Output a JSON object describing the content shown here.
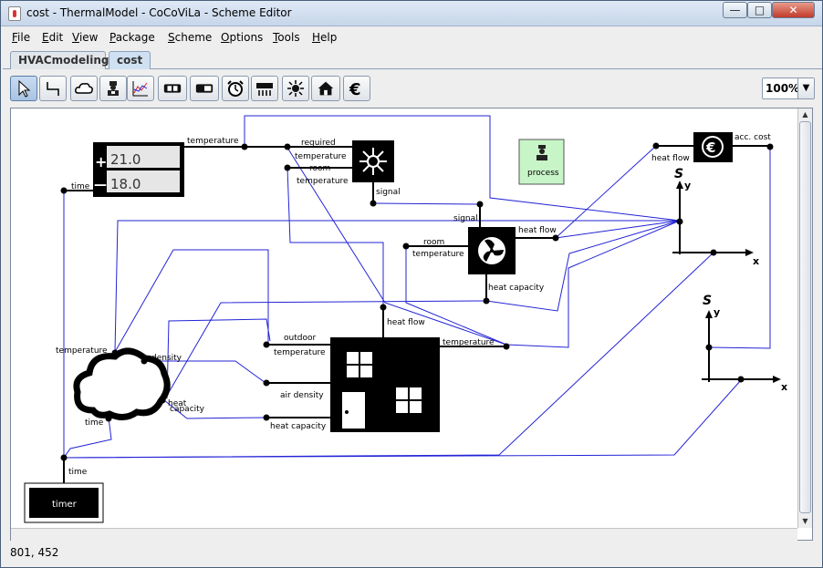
{
  "window": {
    "title": "cost - ThermalModel - CoCoViLa - Scheme Editor",
    "controls": {
      "minimize": "—",
      "maximize": "□",
      "close": "✕"
    }
  },
  "menu": [
    "File",
    "Edit",
    "View",
    "Package",
    "Scheme",
    "Options",
    "Tools",
    "Help"
  ],
  "tabs": [
    {
      "label": "HVACmodeling",
      "active": false
    },
    {
      "label": "cost",
      "active": true
    }
  ],
  "toolbar": {
    "tools": [
      "select-icon",
      "relation-icon",
      "cloud-icon",
      "process-icon",
      "chart-icon",
      "thermostat-icon",
      "toggle-icon",
      "timer-icon",
      "radiator-icon",
      "sun-snow-icon",
      "house-icon",
      "euro-icon"
    ],
    "zoom": "100%"
  },
  "scheme": {
    "thermostat": {
      "plus": "+",
      "minus": "—",
      "high": "21.0",
      "low": "18.0",
      "port_temperature": "temperature",
      "port_time": "time"
    },
    "controller": {
      "port_required": "required",
      "port_required2": "temperature",
      "port_room": "room",
      "port_room2": "temperature",
      "port_signal": "signal"
    },
    "fan": {
      "port_signal": "signal",
      "port_room": "room",
      "port_room2": "temperature",
      "port_heat_flow": "heat flow",
      "port_heat_capacity": "heat capacity"
    },
    "process": {
      "label": "process"
    },
    "cost": {
      "port_heat_flow": "heat flow",
      "port_acc_cost": "acc. cost"
    },
    "plot1": {
      "s": "S",
      "y": "y",
      "x": "x"
    },
    "plot2": {
      "s": "S",
      "y": "y",
      "x": "x"
    },
    "weather": {
      "port_temperature": "temperature",
      "port_density": "density",
      "port_heat": "heat",
      "port_capacity": "capacity",
      "port_time": "time"
    },
    "house": {
      "port_heat_flow": "heat flow",
      "port_outdoor": "outdoor",
      "port_outdoor2": "temperature",
      "port_temperature": "temperature",
      "port_air_density": "air density",
      "port_heat_capacity": "heat capacity"
    },
    "timer": {
      "label": "timer",
      "port_time": "time"
    }
  },
  "status": {
    "coords": "801, 452"
  }
}
